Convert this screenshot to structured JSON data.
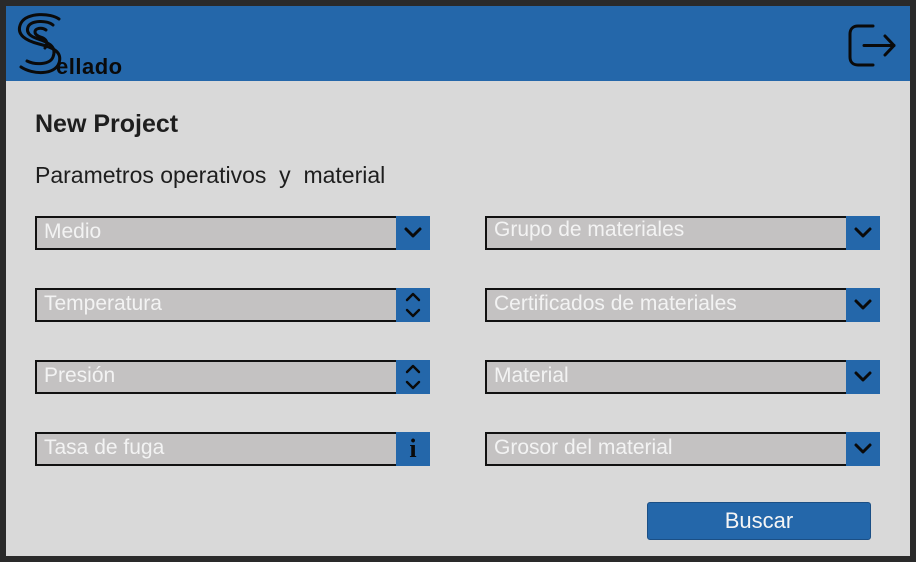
{
  "app": {
    "logo_text": "ellado",
    "brand_color": "#2467aa"
  },
  "page": {
    "title": "New Project",
    "subtitle": "Parametros operativos  y  material"
  },
  "left_fields": [
    {
      "label": "Medio",
      "control": "chevron-down-icon"
    },
    {
      "label": "Temperatura",
      "control": "stepper-up-down-icon"
    },
    {
      "label": "Presión",
      "control": "stepper-up-down-icon"
    },
    {
      "label": "Tasa de fuga",
      "control": "info-icon",
      "info_glyph": "i"
    }
  ],
  "right_fields": [
    {
      "label": "Grupo de materiales",
      "control": "chevron-down-icon"
    },
    {
      "label": "Certificados de materiales",
      "control": "chevron-down-icon"
    },
    {
      "label": "Material",
      "control": "chevron-down-icon"
    },
    {
      "label": "Grosor del material",
      "control": "chevron-down-icon"
    }
  ],
  "actions": {
    "search_label": "Buscar"
  },
  "icons": {
    "logo": "sellado-s-logo-icon",
    "logout": "logout-icon"
  }
}
